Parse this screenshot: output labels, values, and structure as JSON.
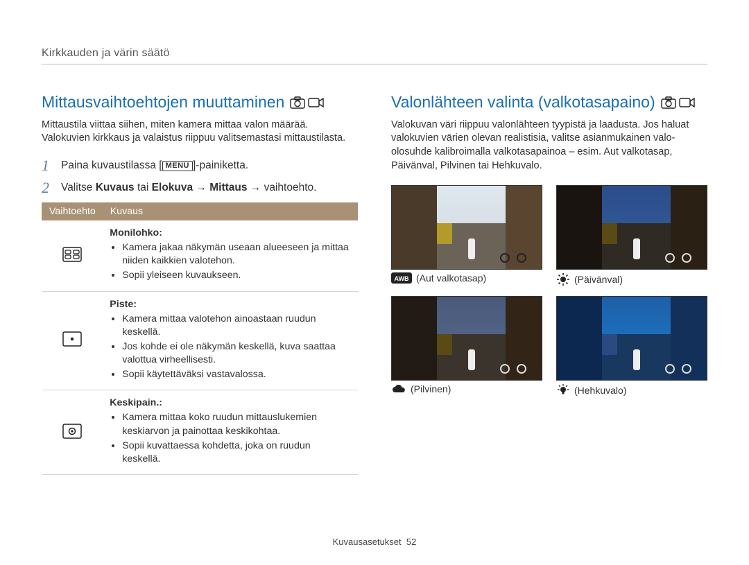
{
  "breadcrumb": "Kirkkauden ja värin säätö",
  "left": {
    "heading": "Mittausvaihtoehtojen muuttaminen",
    "intro": "Mittaustila viittaa siihen, miten kamera mittaa valon määrää. Valokuvien kirkkaus ja valaistus riippuu valitsemastasi mittaustilasta.",
    "step1_pre": "Paina kuvaustilassa [",
    "step1_menu": "MENU",
    "step1_post": "]-painiketta.",
    "step2_a": "Valitse ",
    "step2_b1": "Kuvaus",
    "step2_c": " tai ",
    "step2_b2": "Elokuva",
    "step2_d": " → ",
    "step2_b3": "Mittaus",
    "step2_e": " → vaihtoehto.",
    "table": {
      "col1": "Vaihtoehto",
      "col2": "Kuvaus",
      "rows": [
        {
          "icon": "multi",
          "title": "Monilohko:",
          "bullets": [
            "Kamera jakaa näkymän useaan alueeseen ja mittaa niiden kaikkien valotehon.",
            "Sopii yleiseen kuvaukseen."
          ]
        },
        {
          "icon": "spot",
          "title": "Piste:",
          "bullets": [
            "Kamera mittaa valotehon ainoastaan ruudun keskellä.",
            "Jos kohde ei ole näkymän keskellä, kuva saattaa valottua virheellisesti.",
            "Sopii käytettäväksi vastavalossa."
          ]
        },
        {
          "icon": "center",
          "title": "Keskipain.:",
          "bullets": [
            "Kamera mittaa koko ruudun mittauslukemien keskiarvon ja painottaa keskikohtaa.",
            "Sopii kuvattaessa kohdetta, joka on ruudun keskellä."
          ]
        }
      ]
    }
  },
  "right": {
    "heading": "Valonlähteen valinta (valkotasapaino)",
    "intro": "Valokuvan väri riippuu valonlähteen tyypistä ja laadusta. Jos haluat valokuvien värien olevan realistisia, valitse asianmukainen valo-olosuhde kalibroimalla valkotasapainoa – esim. Aut valkotasap, Päivänval, Pilvinen tai Hehkuvalo.",
    "samples": [
      {
        "key": "awb",
        "label": "(Aut valkotasap)",
        "icon": "awb"
      },
      {
        "key": "day",
        "label": "(Päivänval)",
        "icon": "sun"
      },
      {
        "key": "clo",
        "label": "(Pilvinen)",
        "icon": "cloud"
      },
      {
        "key": "inc",
        "label": "(Hehkuvalo)",
        "icon": "bulb"
      }
    ]
  },
  "footer": {
    "section": "Kuvausasetukset",
    "page": "52"
  }
}
